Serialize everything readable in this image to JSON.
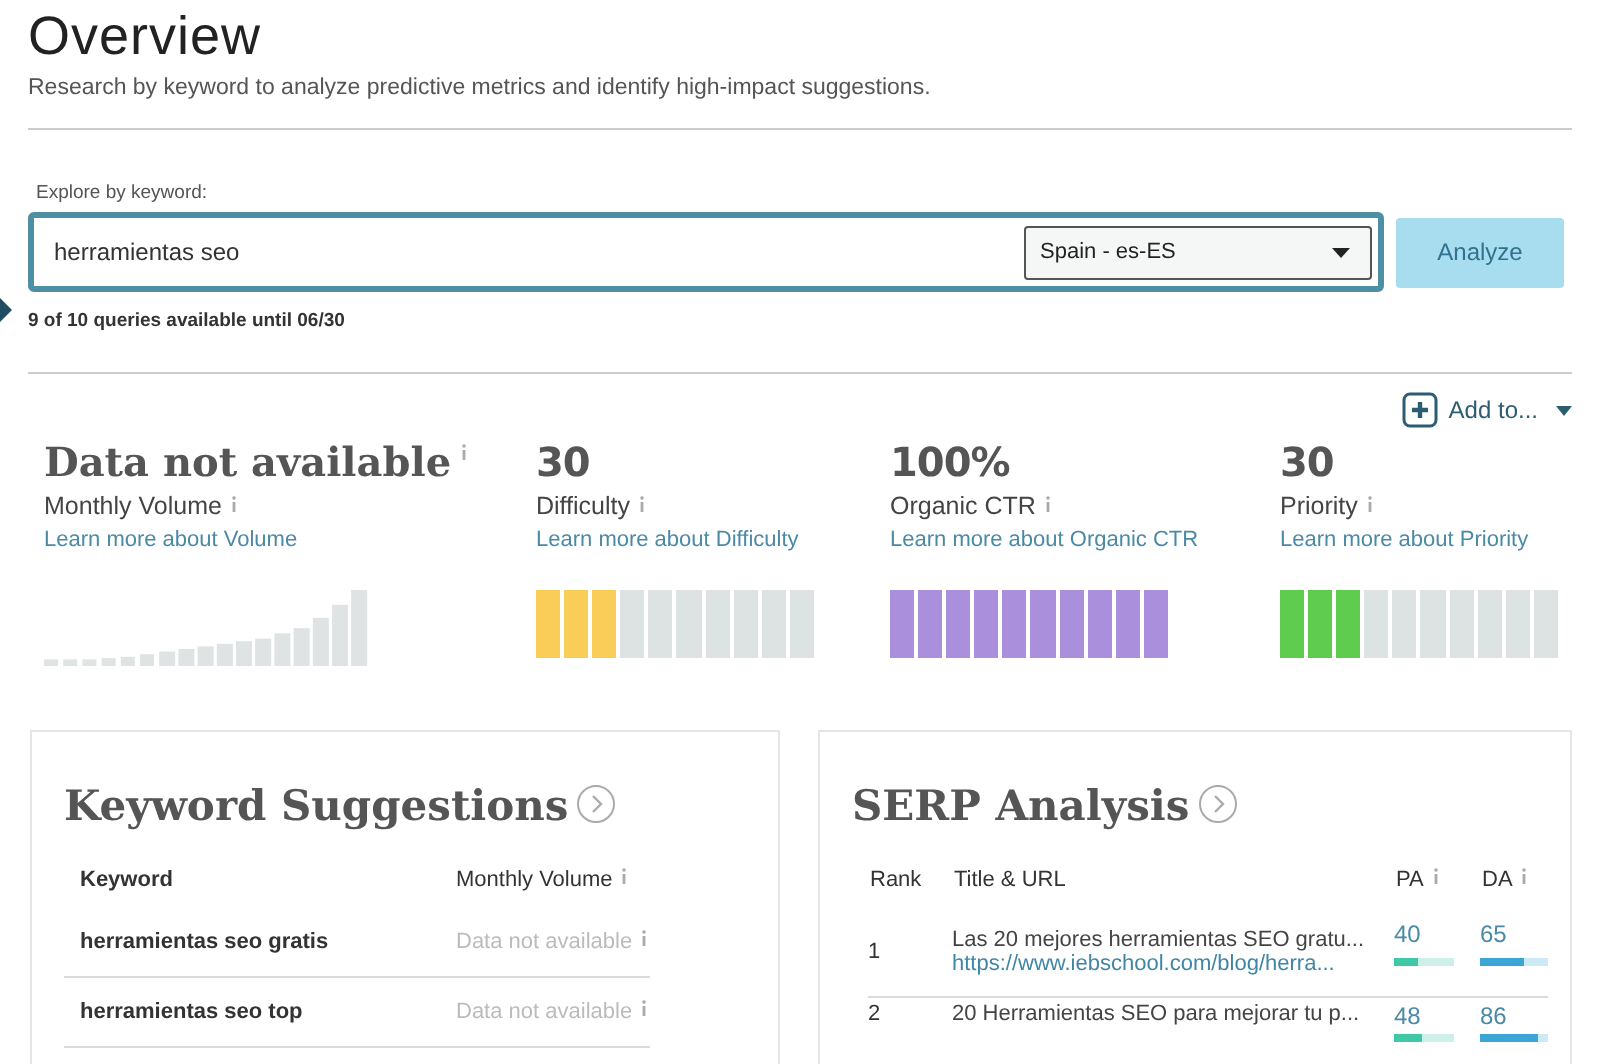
{
  "header": {
    "title": "Overview",
    "subtitle": "Research by keyword to analyze predictive metrics and identify high-impact suggestions."
  },
  "search": {
    "label": "Explore by keyword:",
    "value": "herramientas seo",
    "locale": "Spain - es-ES",
    "button": {
      "label": "Analyze",
      "disabled": true
    },
    "quota": "9 of 10 queries available until 06/30"
  },
  "add_to": {
    "label": "Add to..."
  },
  "metrics": [
    {
      "kind": "volume",
      "value": "Data not available",
      "label": "Monthly Volume",
      "link": "Learn more about Volume"
    },
    {
      "kind": "segments",
      "value": "30",
      "label": "Difficulty",
      "link": "Learn more about Difficulty",
      "level": 0.3,
      "color": "#f9cd57"
    },
    {
      "kind": "segments",
      "value": "100%",
      "label": "Organic CTR",
      "link": "Learn more about Organic CTR",
      "level": 1,
      "color": "#a98fdc"
    },
    {
      "kind": "segments",
      "value": "30",
      "label": "Priority",
      "link": "Learn more about Priority",
      "level": 0.3,
      "color": "#5fcb4f"
    }
  ],
  "keyword_suggestions": {
    "title": "Keyword Suggestions",
    "columns": [
      "Keyword",
      "Monthly Volume"
    ],
    "rows": [
      {
        "keyword": "herramientas seo gratis",
        "monthly_volume": "Data not available"
      },
      {
        "keyword": "herramientas seo top",
        "monthly_volume": "Data not available"
      }
    ]
  },
  "serp_analysis": {
    "title": "SERP Analysis",
    "columns": [
      "Rank",
      "Title & URL",
      "PA",
      "DA"
    ],
    "rows": [
      {
        "rank": "1",
        "title": "Las 20 mejores herramientas SEO gratu...",
        "url": "https://www.iebschool.com/blog/herra...",
        "pa": {
          "value": "40",
          "level": 0.4
        },
        "da": {
          "value": "65",
          "level": 0.65
        }
      },
      {
        "rank": "2",
        "title": "20 Herramientas SEO para mejorar tu p...",
        "pa": {
          "value": "48",
          "level": 0.48
        },
        "da": {
          "value": "86",
          "level": 0.86
        }
      }
    ]
  }
}
